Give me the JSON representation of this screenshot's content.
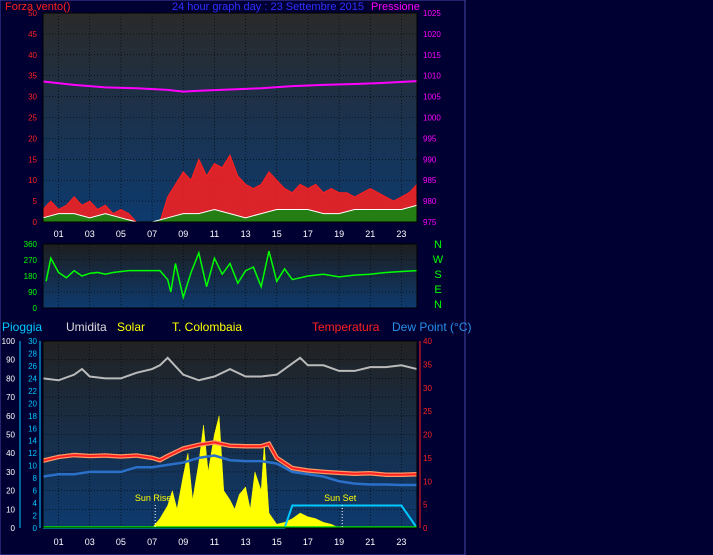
{
  "title": "24 hour graph day : 23 Settembre 2015",
  "x_ticks": [
    "01",
    "03",
    "05",
    "07",
    "09",
    "11",
    "13",
    "15",
    "17",
    "19",
    "21",
    "23"
  ],
  "colors": {
    "page_bg": "#000033",
    "panel_bg_top": "#222222",
    "panel_bg_bottom": "#0d3a6e",
    "wind": "#ff2020",
    "wind_avg": "#ffffff",
    "wind_fill": "#118811",
    "pressure": "#ff00ff",
    "direction": "#00ff00",
    "rain": "#00c8ff",
    "humidity": "#bbbbbb",
    "solar": "#ffff00",
    "temp": "#ff2020",
    "temp_outline": "#ff9966",
    "dewpoint": "#2a6fc8"
  },
  "chart_data": [
    {
      "type": "line",
      "name": "wind-pressure",
      "labels": {
        "left": "Forza vento()",
        "right": "Pressione"
      },
      "left_ticks": [
        "50",
        "45",
        "40",
        "35",
        "30",
        "25",
        "20",
        "15",
        "10",
        "5",
        "0"
      ],
      "right_ticks": [
        "1025",
        "1020",
        "1015",
        "1010",
        "1005",
        "1000",
        "995",
        "990",
        "985",
        "980",
        "975"
      ],
      "ylim_left": [
        0,
        50
      ],
      "ylim_right": [
        975,
        1025
      ],
      "xlim": [
        0,
        24
      ],
      "series": [
        {
          "key": "pressure",
          "axis": "right",
          "x": [
            0,
            2,
            4,
            6,
            8,
            9,
            10,
            12,
            14,
            16,
            18,
            20,
            22,
            24
          ],
          "y": [
            1008.6,
            1007.8,
            1007.2,
            1007.0,
            1006.6,
            1006.2,
            1006.4,
            1006.7,
            1007.0,
            1007.5,
            1007.8,
            1008.0,
            1008.3,
            1008.7
          ]
        },
        {
          "key": "wind_gust",
          "axis": "left",
          "x": [
            0,
            0.5,
            1,
            1.5,
            2,
            2.5,
            3,
            3.5,
            4,
            4.5,
            5,
            5.5,
            6,
            6.5,
            7,
            7.5,
            8,
            8.5,
            9,
            9.5,
            10,
            10.5,
            11,
            11.5,
            12,
            12.5,
            13,
            13.5,
            14,
            14.5,
            15,
            15.5,
            16,
            16.5,
            17,
            17.5,
            18,
            18.5,
            19,
            19.5,
            20,
            20.5,
            21,
            21.5,
            22,
            22.5,
            23,
            23.5,
            24
          ],
          "y": [
            3,
            5,
            3,
            4,
            6,
            4,
            5,
            3,
            4,
            2,
            3,
            2,
            0,
            0,
            0,
            0,
            6,
            9,
            12,
            10,
            15,
            11,
            14,
            13,
            16,
            11,
            9,
            8,
            9,
            12,
            10,
            8,
            7,
            9,
            8,
            9,
            7,
            8,
            7,
            7,
            6,
            7,
            8,
            7,
            6,
            5,
            6,
            7,
            9
          ]
        },
        {
          "key": "wind_avg",
          "axis": "left",
          "x": [
            0,
            1,
            2,
            3,
            4,
            5,
            6,
            7,
            8,
            9,
            10,
            11,
            12,
            13,
            14,
            15,
            16,
            17,
            18,
            19,
            20,
            21,
            22,
            23,
            24
          ],
          "y": [
            1,
            2,
            2,
            1,
            2,
            1,
            0,
            0,
            1,
            2,
            2,
            3,
            2,
            1,
            2,
            3,
            3,
            3,
            2,
            2,
            3,
            3,
            3,
            3,
            4
          ]
        }
      ]
    },
    {
      "type": "scatter",
      "name": "wind-direction",
      "left_ticks": [
        "360",
        "270",
        "180",
        "90",
        "0"
      ],
      "right_labels": [
        "N",
        "W",
        "S",
        "E",
        "N"
      ],
      "ylim": [
        0,
        360
      ],
      "xlim": [
        0,
        24
      ],
      "series": [
        {
          "key": "direction",
          "x": [
            0.2,
            0.5,
            1,
            1.5,
            2,
            2.5,
            3,
            3.5,
            4,
            4.5,
            5,
            5.5,
            6,
            6.5,
            7,
            7.5,
            8,
            8.2,
            8.5,
            9,
            9.5,
            10,
            10.5,
            11,
            11.5,
            12,
            12.5,
            13,
            13.5,
            14,
            14.5,
            15,
            15.5,
            16,
            17,
            18,
            19,
            20,
            21,
            22,
            23,
            24
          ],
          "y": [
            150,
            280,
            200,
            170,
            210,
            180,
            195,
            200,
            190,
            200,
            205,
            210,
            210,
            210,
            210,
            210,
            160,
            90,
            250,
            60,
            200,
            310,
            120,
            280,
            190,
            250,
            140,
            210,
            230,
            120,
            320,
            150,
            220,
            160,
            180,
            190,
            175,
            185,
            190,
            200,
            205,
            210
          ]
        }
      ]
    },
    {
      "type": "area",
      "name": "rain-humidity-solar-temp",
      "labels": {
        "rain": "Pioggia",
        "humidity": "Umidita",
        "solar": "Solar",
        "temp_station": "T. Colombaia",
        "temp": "Temperatura",
        "dewpoint": "Dew Point (°C)"
      },
      "rain_ticks": [
        "100",
        "90",
        "80",
        "70",
        "60",
        "50",
        "40",
        "30",
        "20",
        "10",
        "0"
      ],
      "solar_ticks": [
        "30",
        "28",
        "26",
        "24",
        "22",
        "20",
        "18",
        "16",
        "14",
        "12",
        "10",
        "8",
        "6",
        "4",
        "2",
        "0"
      ],
      "temp_ticks": [
        "40",
        "35",
        "30",
        "25",
        "20",
        "15",
        "10",
        "5",
        "0"
      ],
      "ylim_humidity": [
        0,
        100
      ],
      "ylim_temp": [
        0,
        40
      ],
      "xlim": [
        0,
        24
      ],
      "annotations": [
        {
          "text": "Sun Rise",
          "x": 7.2
        },
        {
          "text": "Sun Set",
          "x": 19.2
        }
      ],
      "series": [
        {
          "key": "humidity",
          "axis": "humidity",
          "x": [
            0,
            1,
            2,
            2.5,
            3,
            4,
            5,
            6,
            7,
            7.5,
            8,
            9,
            10,
            11,
            12,
            13,
            14,
            15,
            16,
            16.5,
            17,
            18,
            19,
            20,
            21,
            22,
            23,
            24
          ],
          "y": [
            80,
            79,
            82,
            85,
            81,
            80,
            80,
            83,
            85,
            87,
            91,
            82,
            79,
            81,
            85,
            81,
            81,
            82,
            88,
            91,
            87,
            87,
            84,
            84,
            86,
            86,
            87,
            85
          ]
        },
        {
          "key": "temp",
          "axis": "temp",
          "x": [
            0,
            1,
            2,
            3,
            4,
            5,
            6,
            7,
            7.5,
            8,
            8.5,
            9,
            10,
            11,
            12,
            13,
            14,
            14.5,
            15,
            16,
            17,
            18,
            19,
            20,
            21,
            22,
            23,
            24
          ],
          "y": [
            14.4,
            15.2,
            15.6,
            15.4,
            15.5,
            15.3,
            15.5,
            15.0,
            14.5,
            15.4,
            16.2,
            17,
            17.8,
            18.3,
            17.6,
            17.5,
            17.5,
            18,
            15,
            12.8,
            12.3,
            12.0,
            11.8,
            11.6,
            11.7,
            11.4,
            11.4,
            11.5
          ]
        },
        {
          "key": "dewpoint",
          "axis": "temp",
          "x": [
            0,
            1,
            2,
            3,
            4,
            5,
            6,
            7,
            8,
            9,
            10,
            11,
            12,
            13,
            14,
            15,
            16,
            17,
            18,
            19,
            20,
            21,
            22,
            23,
            24
          ],
          "y": [
            11,
            11.5,
            11.5,
            12,
            12,
            12,
            13,
            13,
            13.5,
            14,
            15,
            15.5,
            14.5,
            14.3,
            14.3,
            13.8,
            12,
            11.5,
            11,
            10,
            9.5,
            9.3,
            9.3,
            9.2,
            9.2
          ]
        },
        {
          "key": "solar",
          "axis": "humidity",
          "x": [
            6.5,
            7,
            7.5,
            8,
            8.3,
            8.6,
            9,
            9.3,
            9.6,
            10,
            10.3,
            10.6,
            11,
            11.3,
            11.6,
            12,
            12.3,
            12.6,
            13,
            13.3,
            13.6,
            14,
            14.2,
            14.5,
            15,
            15.5,
            16,
            16.5,
            17,
            17.5,
            18,
            18.5,
            19,
            19.5
          ],
          "y": [
            0,
            0,
            5,
            12,
            20,
            10,
            28,
            40,
            15,
            35,
            55,
            30,
            50,
            60,
            20,
            15,
            10,
            18,
            22,
            10,
            30,
            20,
            45,
            8,
            2,
            3,
            5,
            8,
            6,
            5,
            3,
            2,
            0,
            0
          ]
        },
        {
          "key": "rain",
          "axis": "humidity",
          "x": [
            0,
            15.5,
            16,
            19,
            20,
            23,
            24
          ],
          "y": [
            0,
            0,
            12,
            12,
            12,
            12,
            0
          ]
        }
      ]
    }
  ]
}
